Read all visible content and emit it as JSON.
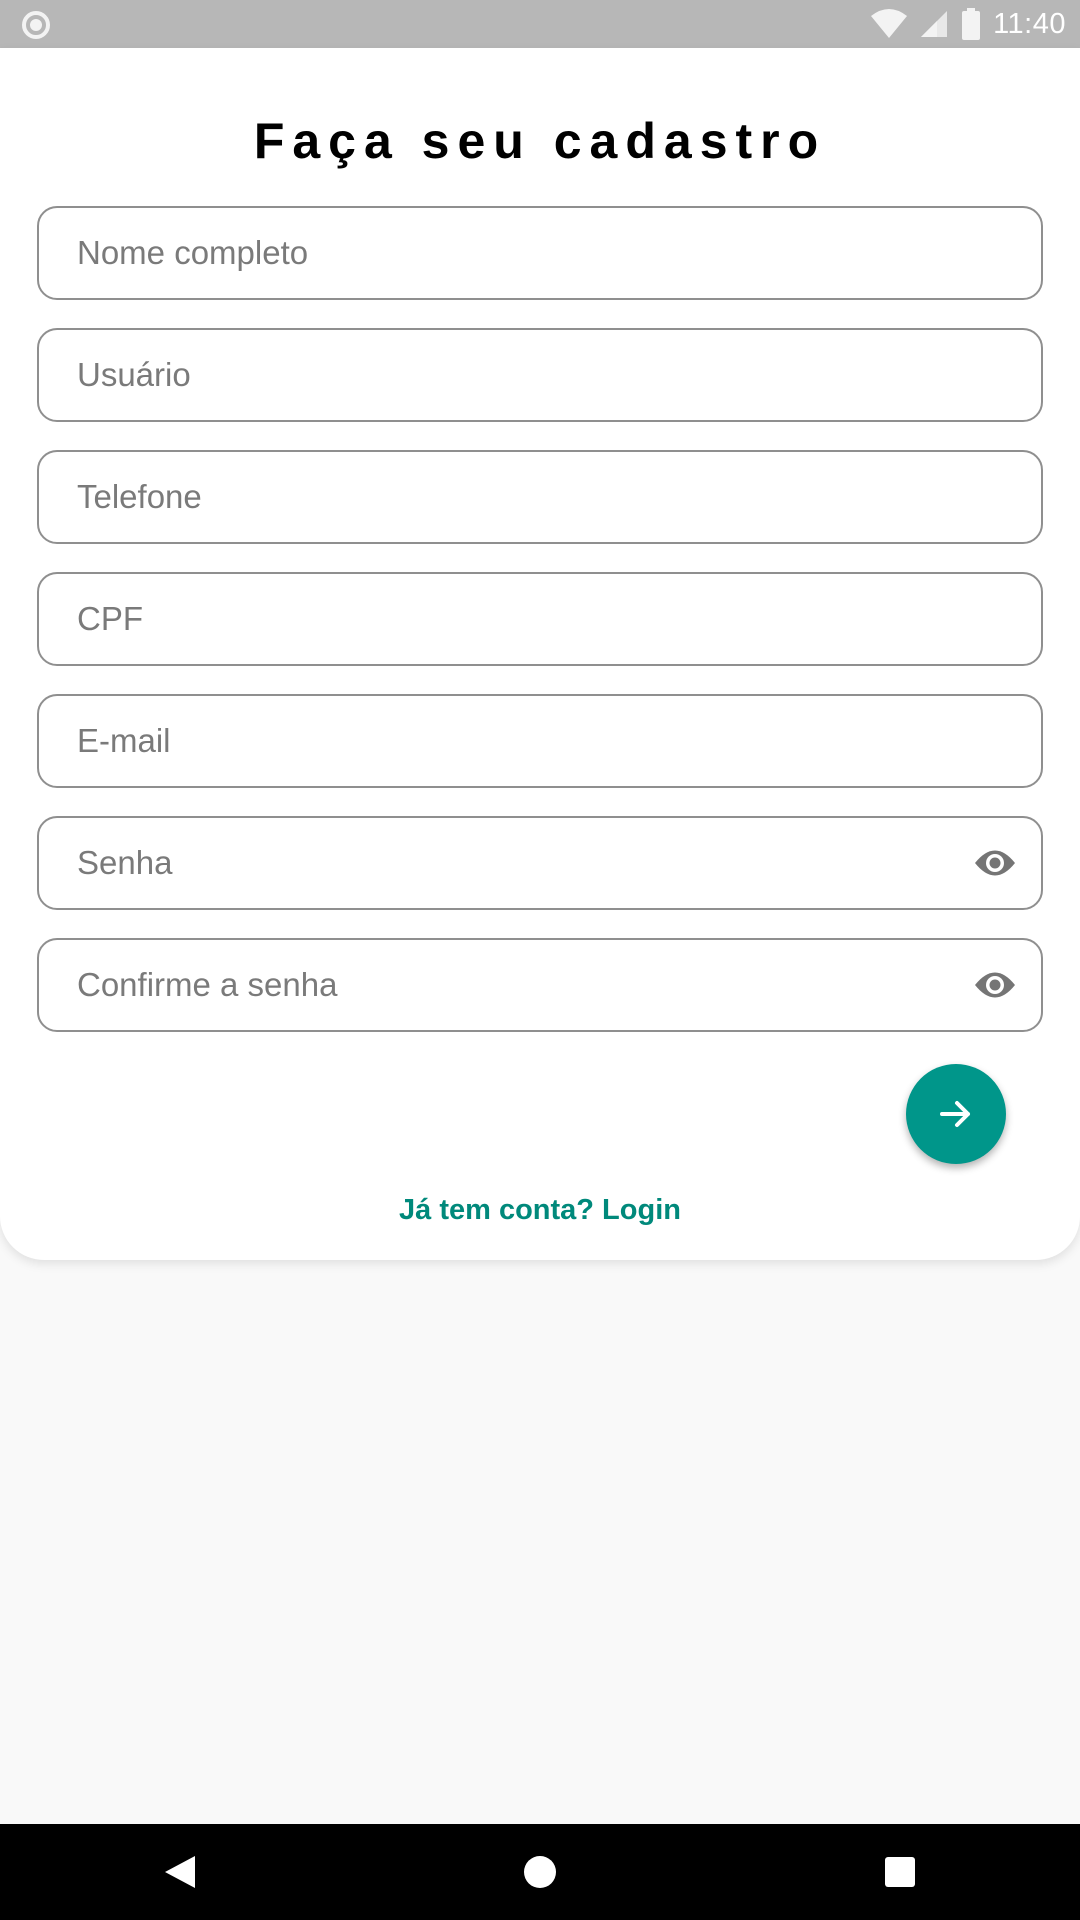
{
  "status_bar": {
    "time": "11:40",
    "icons": [
      "notification-icon",
      "wifi-icon",
      "cellular-icon",
      "battery-icon"
    ]
  },
  "form": {
    "title": "Faça seu cadastro",
    "fields": {
      "full_name": {
        "placeholder": "Nome completo"
      },
      "username": {
        "placeholder": "Usuário"
      },
      "phone": {
        "placeholder": "Telefone"
      },
      "cpf": {
        "placeholder": "CPF"
      },
      "email": {
        "placeholder": "E-mail"
      },
      "password": {
        "placeholder": "Senha",
        "icon": "eye-icon"
      },
      "confirm_password": {
        "placeholder": "Confirme a senha",
        "icon": "eye-icon"
      }
    },
    "submit_icon": "arrow-right-icon",
    "login_link": "Já tem conta? Login"
  },
  "nav_bar": {
    "icons": [
      "back-icon",
      "home-icon",
      "recents-icon"
    ]
  },
  "colors": {
    "accent": "#00968a",
    "link": "#00897b",
    "status_bar": "#b7b7b7",
    "field_border": "#8f8f8f"
  }
}
